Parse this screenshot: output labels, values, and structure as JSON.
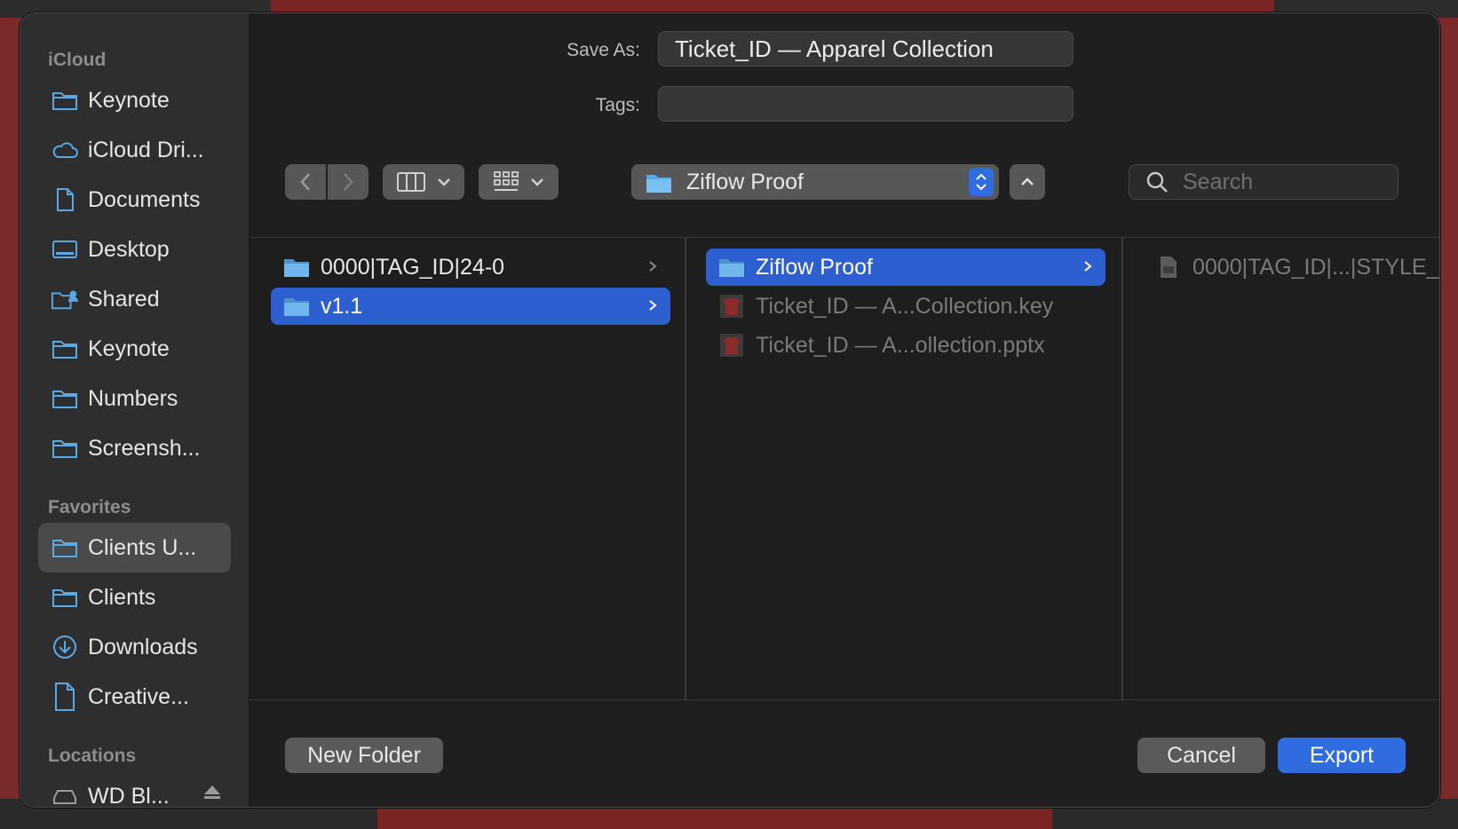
{
  "sidebar": {
    "sections": [
      {
        "title": "iCloud",
        "items": [
          {
            "label": "Keynote",
            "icon": "folder-icon"
          },
          {
            "label": "iCloud Dri...",
            "icon": "cloud-icon"
          },
          {
            "label": "Documents",
            "icon": "document-icon"
          },
          {
            "label": "Desktop",
            "icon": "desktop-icon"
          },
          {
            "label": "Shared",
            "icon": "shared-folder-icon"
          },
          {
            "label": "Keynote",
            "icon": "folder-icon"
          },
          {
            "label": "Numbers",
            "icon": "folder-icon"
          },
          {
            "label": "Screensh...",
            "icon": "folder-icon"
          }
        ]
      },
      {
        "title": "Favorites",
        "items": [
          {
            "label": "Clients U...",
            "icon": "folder-icon",
            "selected": true
          },
          {
            "label": "Clients",
            "icon": "folder-icon"
          },
          {
            "label": "Downloads",
            "icon": "download-icon"
          },
          {
            "label": "Creative...",
            "icon": "document-icon"
          }
        ]
      },
      {
        "title": "Locations",
        "items": [
          {
            "label": "WD Bl...",
            "icon": "drive-icon"
          }
        ]
      }
    ]
  },
  "form": {
    "save_as_label": "Save As:",
    "save_as_value": "Ticket_ID — Apparel Collection",
    "tags_label": "Tags:",
    "tags_value": ""
  },
  "toolbar": {
    "location": "Ziflow Proof",
    "search_placeholder": "Search"
  },
  "columns": [
    {
      "items": [
        {
          "label": "0000|TAG_ID|24-0",
          "type": "folder",
          "chevron": true
        },
        {
          "label": "v1.1",
          "type": "folder",
          "chevron": true,
          "selected": true
        }
      ]
    },
    {
      "items": [
        {
          "label": "Ziflow Proof",
          "type": "folder",
          "chevron": true,
          "selected": true
        },
        {
          "label": "Ticket_ID — A...Collection.key",
          "type": "file",
          "disabled": true
        },
        {
          "label": "Ticket_ID — A...ollection.pptx",
          "type": "file",
          "disabled": true
        }
      ]
    },
    {
      "items": [
        {
          "label": "0000|TAG_ID|...|STYLE_",
          "type": "doc",
          "disabled": true
        }
      ]
    }
  ],
  "footer": {
    "new_folder": "New Folder",
    "cancel": "Cancel",
    "export": "Export"
  },
  "colors": {
    "accent": "#2e6ce0",
    "folder": "#5aa9e6"
  }
}
